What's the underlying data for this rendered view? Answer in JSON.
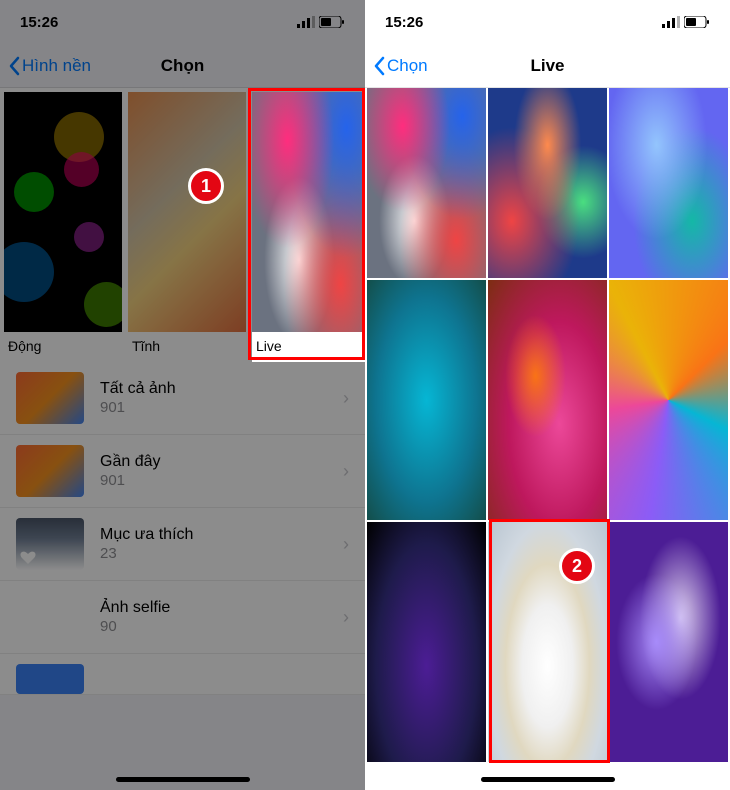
{
  "status": {
    "time": "15:26",
    "signal": "●●●●",
    "battery_icon": "battery"
  },
  "left": {
    "back_label": "Hình nền",
    "title": "Chọn",
    "categories": [
      {
        "label": "Động"
      },
      {
        "label": "Tĩnh"
      },
      {
        "label": "Live"
      }
    ],
    "albums": [
      {
        "name": "Tất cả ảnh",
        "count": "901"
      },
      {
        "name": "Gần đây",
        "count": "901"
      },
      {
        "name": "Mục ưa thích",
        "count": "23"
      },
      {
        "name": "Ảnh selfie",
        "count": "90"
      }
    ],
    "marker": "1"
  },
  "right": {
    "back_label": "Chọn",
    "title": "Live",
    "marker": "2"
  }
}
